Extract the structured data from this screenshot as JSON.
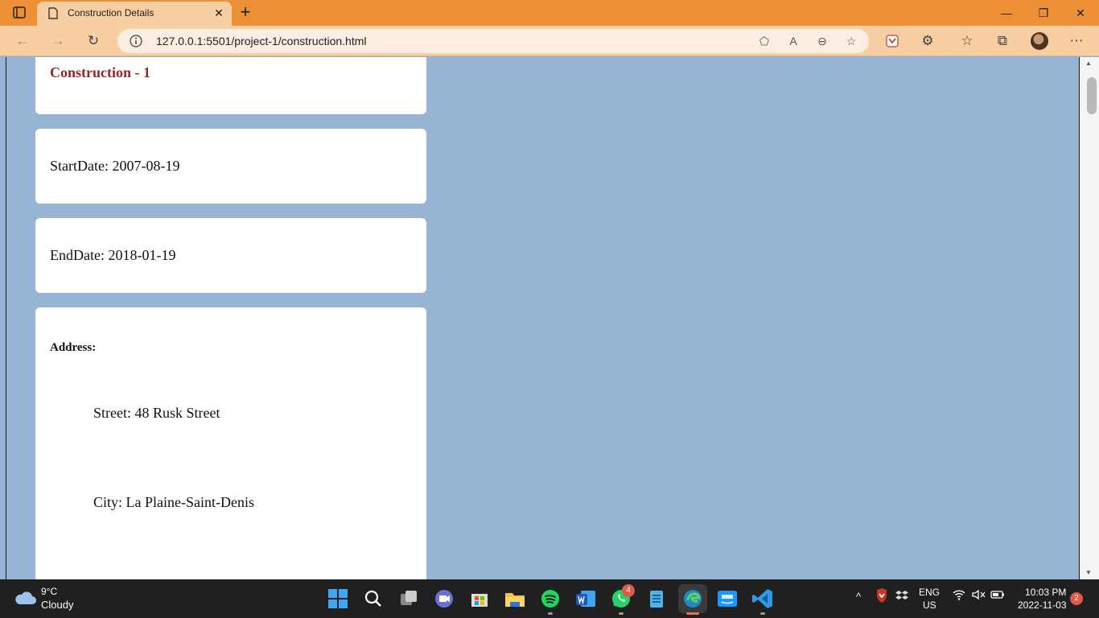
{
  "browser": {
    "tab_title": "Construction Details",
    "tab_close": "✕",
    "new_tab": "+",
    "url": "127.0.0.1:5501/project-1/construction.html",
    "window_controls": {
      "minimize": "—",
      "restore": "❐",
      "close": "✕"
    }
  },
  "page": {
    "title": "Construction - 1",
    "start_date": "StartDate: 2007-08-19",
    "end_date": "EndDate: 2018-01-19",
    "address_label": "Address:",
    "street": "Street: 48 Rusk Street",
    "city": "City: La Plaine-Saint-Denis"
  },
  "taskbar": {
    "weather_temp": "9°C",
    "weather_desc": "Cloudy",
    "whatsapp_badge": "4",
    "lang": "ENG",
    "region": "US",
    "time": "10:03 PM",
    "date": "2022-11-03",
    "notification_count": "2"
  },
  "colors": {
    "title_bar": "#ec8f35",
    "toolbar": "#f7cfa3",
    "page_background": "#97b4d4",
    "card_title": "#8e2a2a"
  }
}
